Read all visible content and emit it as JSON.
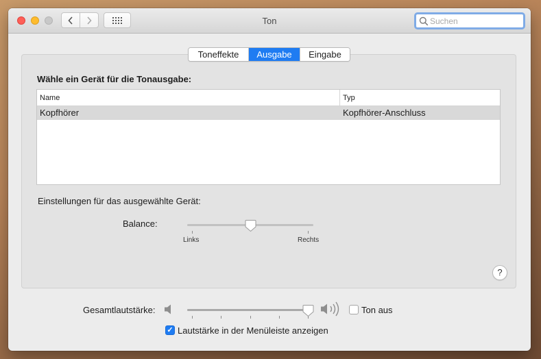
{
  "window": {
    "title": "Ton"
  },
  "toolbar": {
    "back_icon": "chevron-left-icon",
    "forward_icon": "chevron-right-icon",
    "grid_icon": "show-all-grid-icon"
  },
  "search": {
    "placeholder": "Suchen",
    "value": ""
  },
  "tabs": [
    {
      "label": "Toneffekte",
      "active": false
    },
    {
      "label": "Ausgabe",
      "active": true
    },
    {
      "label": "Eingabe",
      "active": false
    }
  ],
  "output": {
    "heading": "Wähle ein Gerät für die Tonausgabe:",
    "columns": {
      "name": "Name",
      "type": "Typ"
    },
    "devices": [
      {
        "name": "Kopfhörer",
        "type": "Kopfhörer-Anschluss",
        "selected": true
      }
    ],
    "settings_label": "Einstellungen für das ausgewählte Gerät:",
    "balance": {
      "label": "Balance:",
      "left_label": "Links",
      "right_label": "Rechts",
      "value": 0.5
    }
  },
  "volume": {
    "label": "Gesamtlautstärke:",
    "value": 0.96,
    "mute_label": "Ton aus",
    "muted": false,
    "menu_label": "Lautstärke in der Menüleiste anzeigen",
    "show_in_menu": true
  },
  "help": {
    "label": "?"
  },
  "colors": {
    "accent": "#1f7cf2",
    "close": "#fe5f57",
    "minimize": "#febc2e"
  }
}
